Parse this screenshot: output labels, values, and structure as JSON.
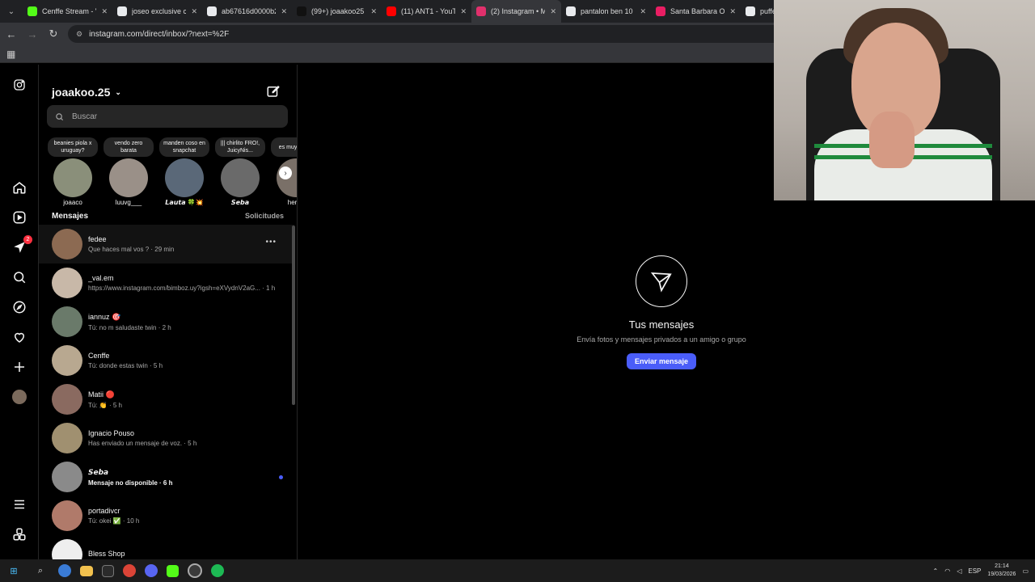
{
  "browser": {
    "tabs": [
      {
        "label": "Cenffe Stream - V",
        "color": "#53fc18"
      },
      {
        "label": "joseo exclusive cl",
        "color": "#e8eaed"
      },
      {
        "label": "ab67616d0000b2",
        "color": "#e8eaed"
      },
      {
        "label": "(99+) joaakoo25 |",
        "color": "#111111"
      },
      {
        "label": "(11) ANT1 - YouT",
        "color": "#ff0000"
      },
      {
        "label": "(2) Instagram • M",
        "color": "#e1306c"
      },
      {
        "label": "pantalon ben 10",
        "color": "#e8eaed"
      },
      {
        "label": "Santa Barbara Ou",
        "color": "#e91e63"
      },
      {
        "label": "puffer",
        "color": "#e8eaed"
      }
    ],
    "url": "instagram.com/direct/inbox/?next=%2F"
  },
  "sidebar": {
    "badge": "2"
  },
  "dm": {
    "username": "joaakoo.25",
    "search_placeholder": "Buscar",
    "notes": [
      {
        "text": "beanies piola x uruguay?",
        "name": "joaaco",
        "color": "#8a8f7a"
      },
      {
        "text": "vendo zero barata",
        "name": "luuvg___",
        "color": "#9a9088"
      },
      {
        "text": "manden coso en snapchat",
        "name": "𝙇𝙖𝙪𝙩𝙖 🍀💥",
        "color": "#5a6878"
      },
      {
        "text": "||| chirlito FRO!, JuicyNis...",
        "name": "𝙎𝙚𝙗𝙖",
        "color": "#6a6a6a"
      },
      {
        "text": "es muy liceo l",
        "name": "hernd",
        "color": "#7a7068"
      }
    ],
    "section_title": "Mensajes",
    "requests_label": "Solicitudes",
    "threads": [
      {
        "name": "fedee",
        "preview": "Que haces mal vos ? · 29 min",
        "color": "#8c6a52"
      },
      {
        "name": "_val.em",
        "preview": "https://www.instagram.com/bimboz.uy?igsh=eXVydnV2aG... · 1 h",
        "color": "#c8b8a8"
      },
      {
        "name": "iannuz 🎯",
        "preview": "Tú: no m saludaste twin · 2 h",
        "color": "#6a7a6a"
      },
      {
        "name": "Cenffe",
        "preview": "Tú: donde estas twin · 5 h",
        "color": "#b8a890"
      },
      {
        "name": "Matii 🔴",
        "preview": "Tú: 👏 · 5 h",
        "color": "#8a6a60"
      },
      {
        "name": "Ignacio Pouso",
        "preview": "Has enviado un mensaje de voz. · 5 h",
        "color": "#a09070"
      },
      {
        "name": "𝙎𝙚𝙗𝙖",
        "preview": "Mensaje no disponible · 6 h",
        "color": "#8a8a8a"
      },
      {
        "name": "portadivcr",
        "preview": "Tú: okei ✅ · 10 h",
        "color": "#b07a6a"
      },
      {
        "name": "Bless Shop",
        "preview": "",
        "color": "#eeeeee"
      }
    ]
  },
  "main": {
    "title": "Tus mensajes",
    "subtitle": "Envía fotos y mensajes privados a un amigo o grupo",
    "button": "Enviar mensaje"
  },
  "taskbar": {
    "lang": "ESP",
    "time": "21:14",
    "date": "19/03/2026"
  }
}
